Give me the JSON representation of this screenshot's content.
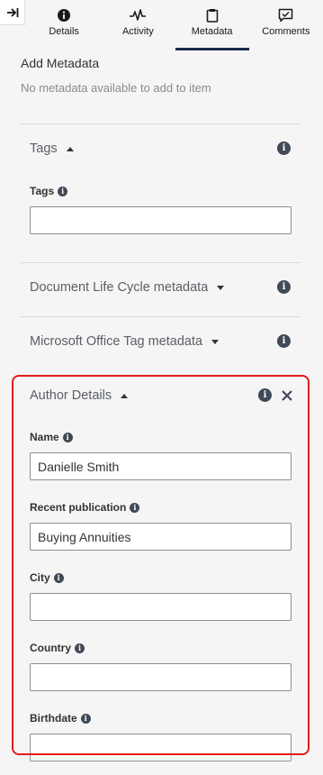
{
  "tabs": [
    {
      "label": "Details",
      "icon": "info-circle-icon"
    },
    {
      "label": "Activity",
      "icon": "pulse-icon"
    },
    {
      "label": "Metadata",
      "icon": "clipboard-icon",
      "active": true
    },
    {
      "label": "Comments",
      "icon": "comment-check-icon"
    }
  ],
  "add_metadata": {
    "title": "Add Metadata",
    "subtitle": "No metadata available to add to item"
  },
  "sections": {
    "tags": {
      "title": "Tags",
      "expanded": true,
      "field_label": "Tags",
      "field_value": ""
    },
    "doc_lifecycle": {
      "title": "Document Life Cycle metadata",
      "expanded": false
    },
    "ms_office": {
      "title": "Microsoft Office Tag metadata",
      "expanded": false
    },
    "author": {
      "title": "Author Details",
      "expanded": true,
      "fields": {
        "name": {
          "label": "Name",
          "value": "Danielle Smith"
        },
        "recent_publication": {
          "label": "Recent publication",
          "value": "Buying Annuities"
        },
        "city": {
          "label": "City",
          "value": ""
        },
        "country": {
          "label": "Country",
          "value": ""
        },
        "birthdate": {
          "label": "Birthdate",
          "value": ""
        }
      }
    }
  },
  "colors": {
    "highlight": "#e21b1b",
    "active_tab": "#1c2a4a",
    "info_icon": "#404a56"
  }
}
